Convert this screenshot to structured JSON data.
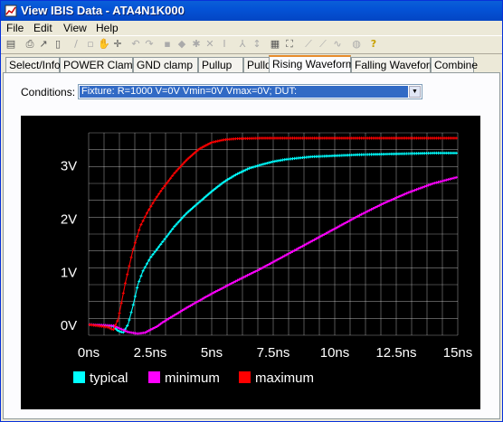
{
  "window": {
    "title": "View IBIS Data - ATA4N1K000"
  },
  "menu": {
    "file": "File",
    "edit": "Edit",
    "view": "View",
    "help": "Help"
  },
  "tabs": [
    {
      "label": "Select/Info"
    },
    {
      "label": "POWER Clamp"
    },
    {
      "label": "GND clamp"
    },
    {
      "label": "Pullup"
    },
    {
      "label": "Pulldown"
    },
    {
      "label": "Rising Waveform"
    },
    {
      "label": "Falling Waveform"
    },
    {
      "label": "Combine"
    }
  ],
  "active_tab": "Rising Waveform",
  "conditions": {
    "label": "Conditions:",
    "selected": "Fixture: R=1000 V=0V Vmin=0V Vmax=0V;  DUT:"
  },
  "colors": {
    "background": "#000000",
    "grid": "#ffffff",
    "typical": "#00ffff",
    "minimum": "#ff00ff",
    "maximum": "#ff0000"
  },
  "chart_data": {
    "type": "line",
    "x_ticks": [
      "0ns",
      "2.5ns",
      "5ns",
      "7.5ns",
      "10ns",
      "12.5ns",
      "15ns"
    ],
    "y_ticks": [
      "0V",
      "1V",
      "2V",
      "3V"
    ],
    "xlim": [
      0,
      15
    ],
    "ylim": [
      -0.2,
      3.6
    ],
    "x_unit": "ns",
    "y_unit": "V",
    "series": [
      {
        "name": "typical",
        "color": "#00ffff",
        "x": [
          0,
          1.0,
          1.2,
          1.4,
          1.6,
          1.8,
          2.0,
          2.2,
          2.5,
          3,
          3.5,
          4,
          4.5,
          5,
          5.5,
          6,
          6.5,
          7,
          7.5,
          8,
          9,
          10,
          11,
          12,
          13,
          14,
          15
        ],
        "y": [
          0,
          -0.03,
          -0.12,
          -0.15,
          0.0,
          0.35,
          0.75,
          1.0,
          1.25,
          1.55,
          1.85,
          2.1,
          2.3,
          2.5,
          2.68,
          2.82,
          2.93,
          3.0,
          3.06,
          3.1,
          3.15,
          3.17,
          3.19,
          3.2,
          3.21,
          3.22,
          3.22
        ]
      },
      {
        "name": "minimum",
        "color": "#ff00ff",
        "x": [
          0,
          1.0,
          1.3,
          1.6,
          2.0,
          2.3,
          2.5,
          2.8,
          3,
          3.5,
          4,
          4.5,
          5,
          5.5,
          6,
          7,
          8,
          9,
          10,
          11,
          12,
          13,
          14,
          15
        ],
        "y": [
          0,
          -0.02,
          -0.08,
          -0.14,
          -0.17,
          -0.15,
          -0.1,
          -0.03,
          0.04,
          0.18,
          0.32,
          0.45,
          0.58,
          0.7,
          0.82,
          1.05,
          1.3,
          1.55,
          1.8,
          2.05,
          2.28,
          2.48,
          2.65,
          2.77
        ]
      },
      {
        "name": "maximum",
        "color": "#ff0000",
        "x": [
          0,
          0.8,
          1.0,
          1.2,
          1.5,
          1.8,
          2.1,
          2.4,
          2.7,
          3,
          3.5,
          4,
          4.5,
          5,
          5.5,
          6,
          7,
          8,
          9,
          10,
          11,
          12,
          13,
          14,
          15
        ],
        "y": [
          0,
          -0.05,
          -0.1,
          0.1,
          0.8,
          1.4,
          1.85,
          2.12,
          2.35,
          2.55,
          2.85,
          3.1,
          3.3,
          3.42,
          3.47,
          3.49,
          3.5,
          3.5,
          3.5,
          3.5,
          3.5,
          3.5,
          3.5,
          3.5,
          3.5
        ]
      }
    ]
  }
}
